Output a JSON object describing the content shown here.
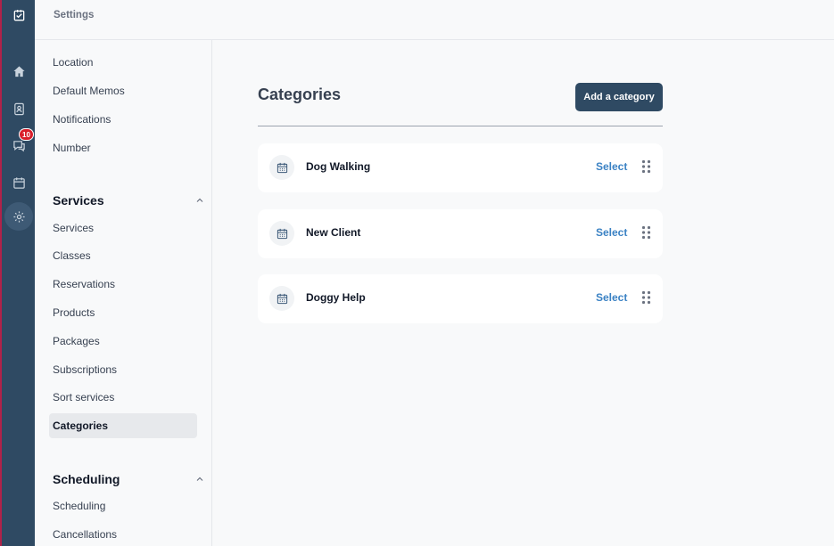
{
  "topbar": {
    "title": "Settings"
  },
  "rail": {
    "badge_count": "10",
    "icons": [
      "checklist-icon",
      "home-icon",
      "contacts-icon",
      "chat-icon",
      "calendar-icon",
      "gear-icon"
    ]
  },
  "sidebar": {
    "top_items": [
      {
        "label": "Location"
      },
      {
        "label": "Default Memos"
      },
      {
        "label": "Notifications"
      },
      {
        "label": "Number"
      }
    ],
    "services": {
      "heading": "Services",
      "items": [
        {
          "label": "Services"
        },
        {
          "label": "Classes"
        },
        {
          "label": "Reservations"
        },
        {
          "label": "Products"
        },
        {
          "label": "Packages"
        },
        {
          "label": "Subscriptions"
        },
        {
          "label": "Sort services"
        },
        {
          "label": "Categories"
        }
      ]
    },
    "scheduling": {
      "heading": "Scheduling",
      "items": [
        {
          "label": "Scheduling"
        },
        {
          "label": "Cancellations"
        }
      ]
    }
  },
  "main": {
    "title": "Categories",
    "add_button": "Add a category",
    "categories": [
      {
        "name": "Dog Walking",
        "action": "Select"
      },
      {
        "name": "New Client",
        "action": "Select"
      },
      {
        "name": "Doggy Help",
        "action": "Select"
      }
    ]
  },
  "colors": {
    "rail": "#2f4a63",
    "accent_link": "#3b82c4",
    "badge": "#d91e2a",
    "active_nav": "#e7e9ec"
  }
}
